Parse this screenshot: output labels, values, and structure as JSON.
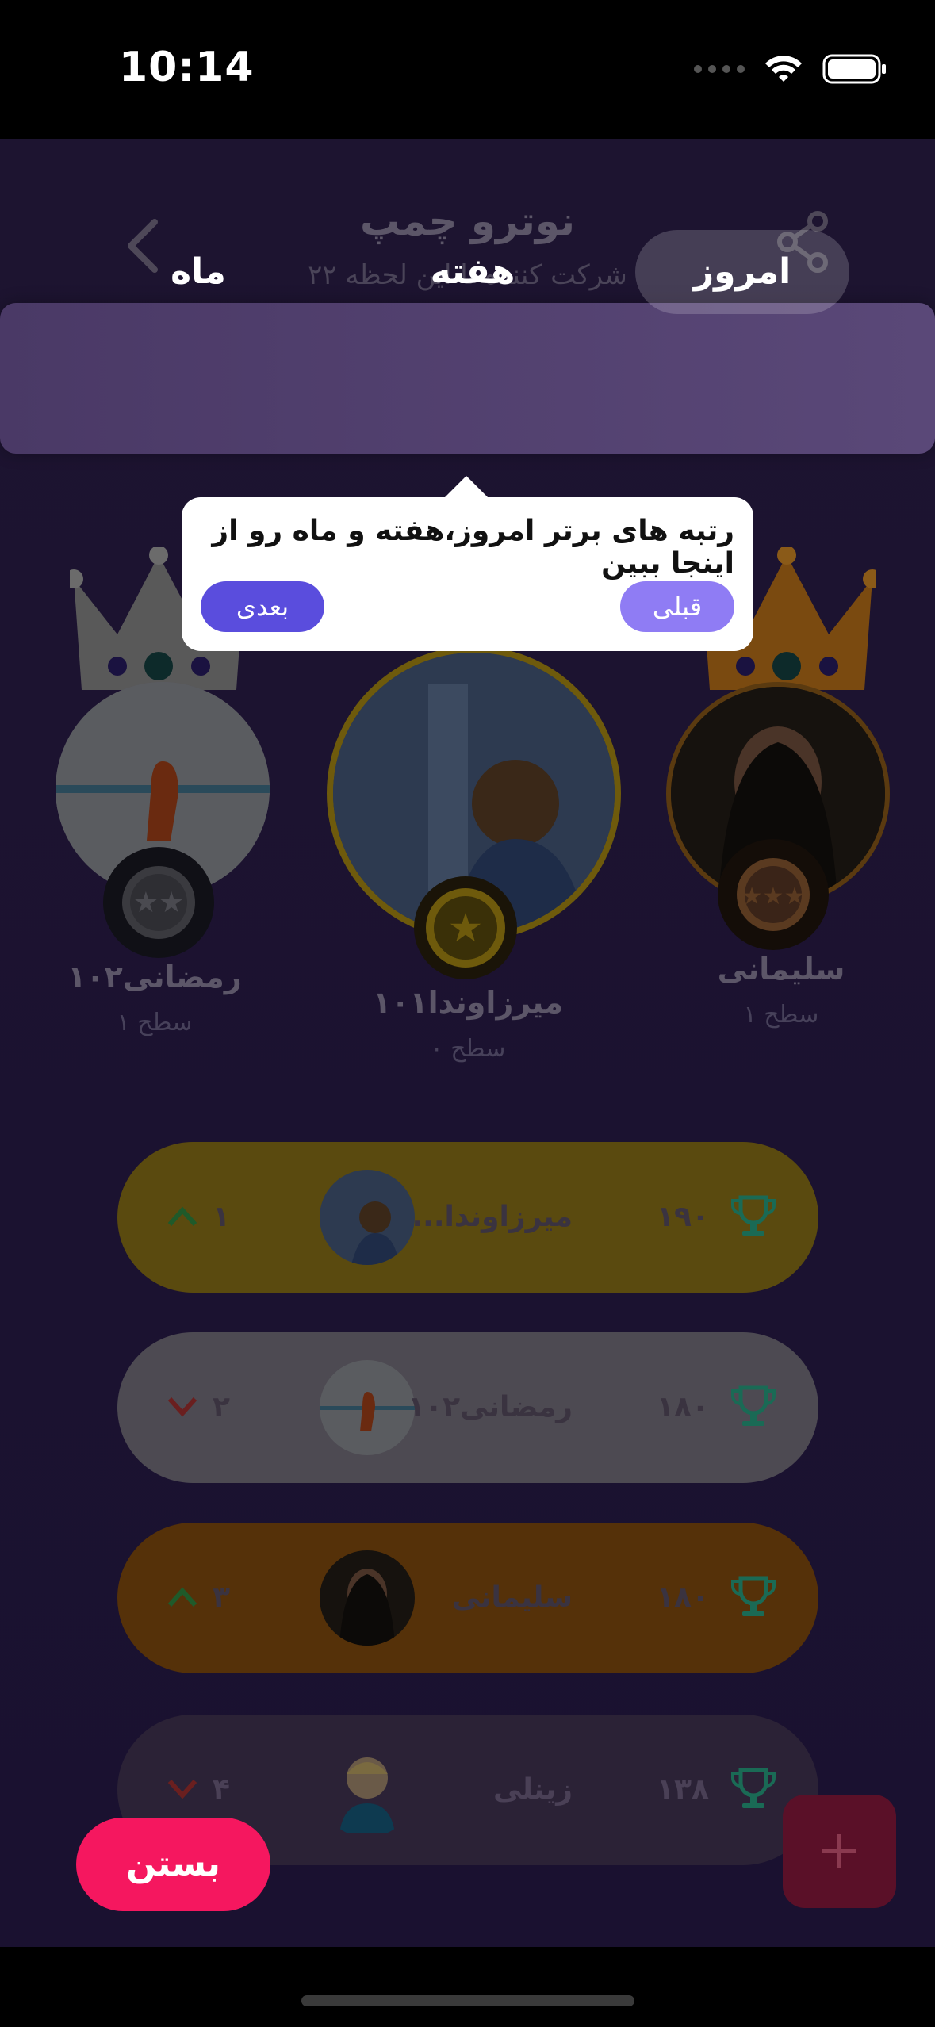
{
  "status_bar": {
    "time": "10:14"
  },
  "header": {
    "title": "نوترو چمپ",
    "subtitle": "۲۲ شرکت کننده تا این لحظه"
  },
  "tabs": [
    {
      "label": "امروز",
      "active": true
    },
    {
      "label": "هفته",
      "active": false
    },
    {
      "label": "ماه",
      "active": false
    }
  ],
  "tooltip": {
    "text": "رتبه های برتر امروز،هفته و ماه رو از اینجا ببین",
    "prev_label": "قبلی",
    "next_label": "بعدی"
  },
  "podium": [
    {
      "name": "میرزاوندا۱۰۱",
      "level": "سطح ۰",
      "rank": 1,
      "crown_color": "#8a6a10"
    },
    {
      "name": "رمضانی۱۰۲",
      "level": "سطح ۱",
      "rank": 2,
      "crown_color": "#6b6b6b"
    },
    {
      "name": "سلیمانی",
      "level": "سطح ۱",
      "rank": 3,
      "crown_color": "#7a4a10"
    }
  ],
  "leaderboard": [
    {
      "rank": "۱",
      "name": "میرزاوندا...",
      "score": "۱۹۰",
      "trend": "up",
      "color": "#5a4a0f"
    },
    {
      "rank": "۲",
      "name": "رمضانی۱۰۲",
      "score": "۱۸۰",
      "trend": "down",
      "color": "#4d4a52"
    },
    {
      "rank": "۳",
      "name": "سلیمانی",
      "score": "۱۸۰",
      "trend": "up",
      "color": "#553109"
    },
    {
      "rank": "۴",
      "name": "زینلی",
      "score": "۱۳۸",
      "trend": "down",
      "color": "#2b2236"
    }
  ],
  "close_label": "بستن",
  "colors": {
    "accent": "#f5175f",
    "tooltip_prev": "#8f7cf4",
    "tooltip_next": "#5a4ddd",
    "trophy": "#1a6a55",
    "trend_up": "#1f5a2a",
    "trend_down": "#6a1f1f"
  }
}
